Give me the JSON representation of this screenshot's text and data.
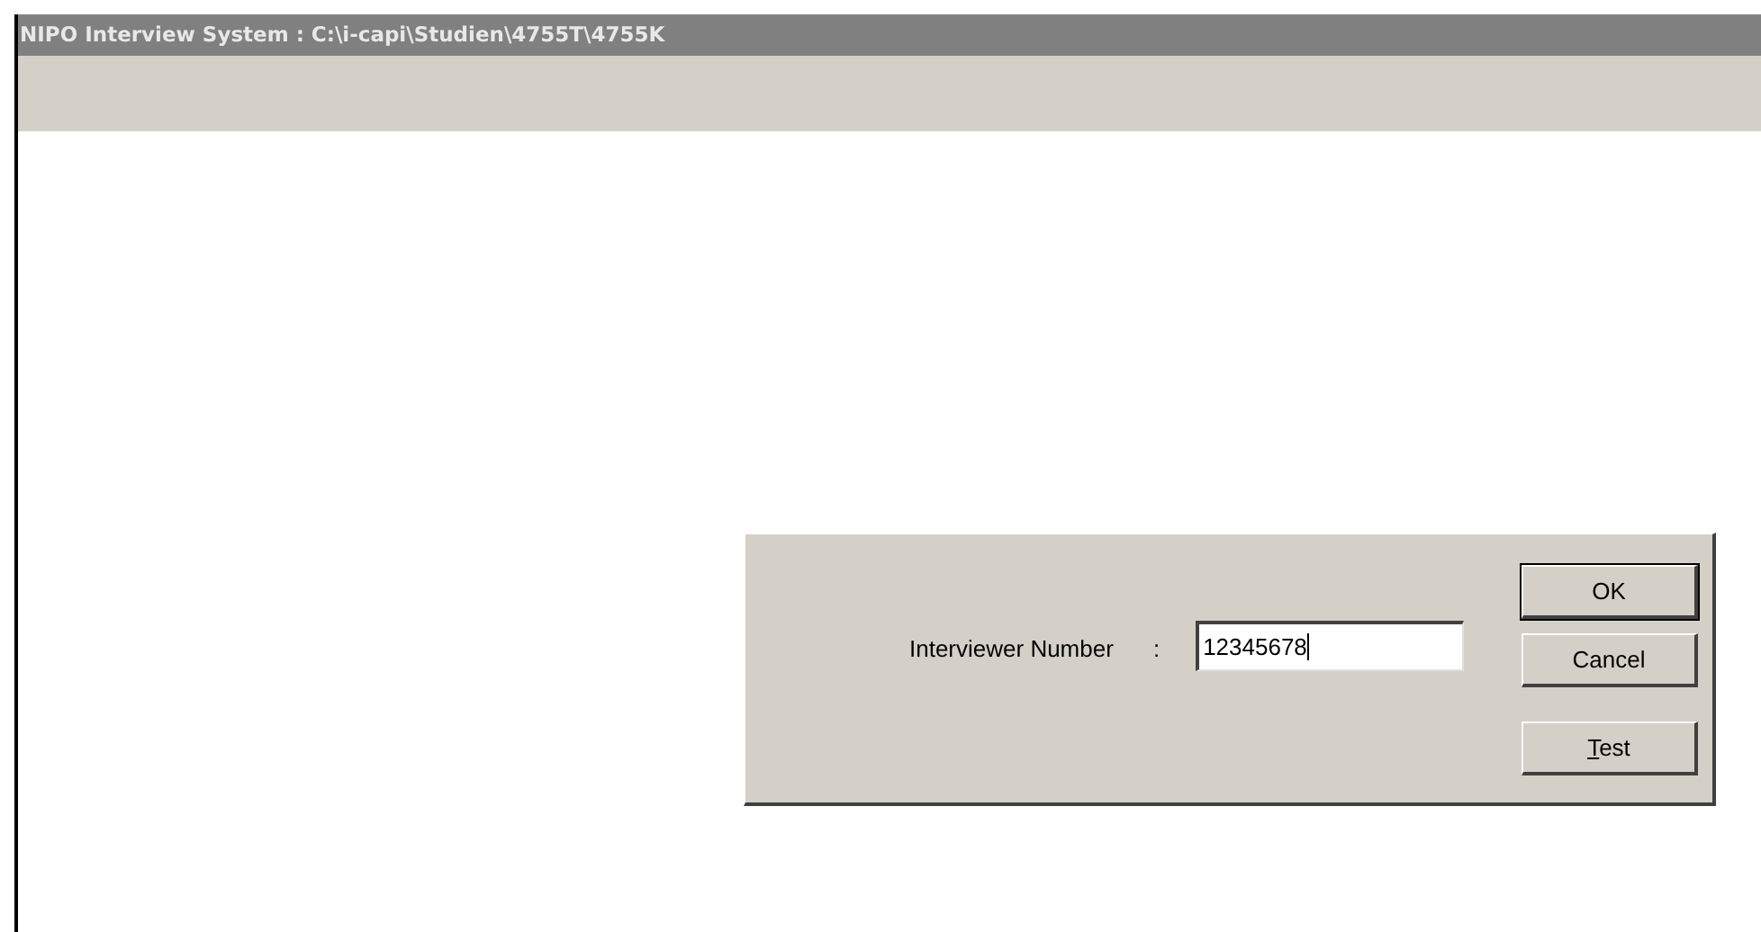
{
  "window": {
    "title": "NIPO Interview System : C:\\i-capi\\Studien\\4755T\\4755K"
  },
  "dialog": {
    "label": "Interviewer Number",
    "separator": ":",
    "field": {
      "value": "12345678",
      "focused": true
    },
    "buttons": [
      {
        "label": "OK",
        "default": true,
        "underline_first": false
      },
      {
        "label": "Cancel",
        "default": false,
        "underline_first": false
      },
      {
        "label": "Test",
        "default": false,
        "underline_first": true
      }
    ]
  }
}
